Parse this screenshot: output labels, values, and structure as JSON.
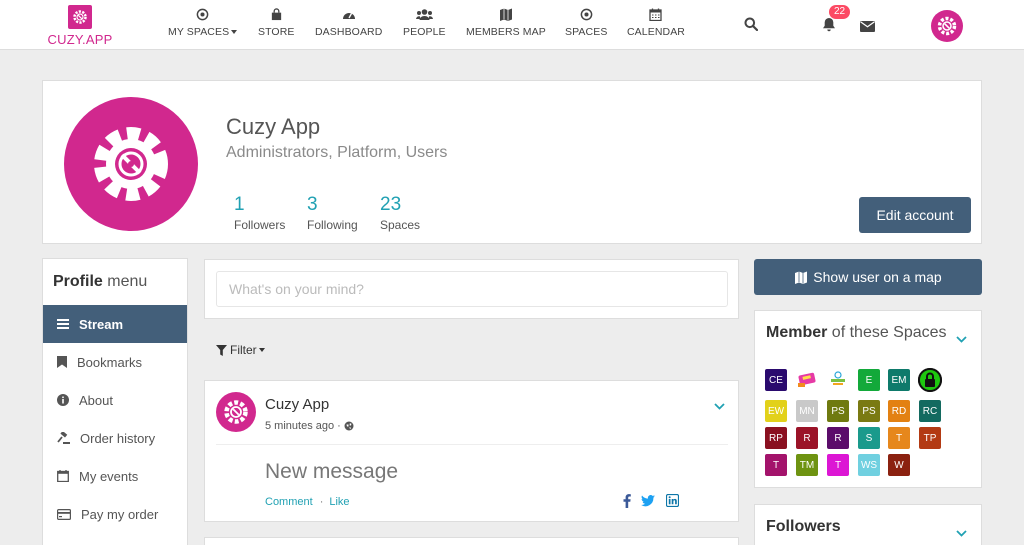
{
  "app": {
    "name": "CUZY.APP",
    "brand_color": "#d1288e",
    "accent_color": "#435f7a",
    "link_color": "#21a1b3"
  },
  "nav": {
    "items": [
      {
        "label": "MY SPACES",
        "icon": "dot-circle-icon"
      },
      {
        "label": "STORE",
        "icon": "shopping-bag-icon"
      },
      {
        "label": "DASHBOARD",
        "icon": "dashboard-gauge-icon"
      },
      {
        "label": "PEOPLE",
        "icon": "users-icon"
      },
      {
        "label": "MEMBERS MAP",
        "icon": "map-icon"
      },
      {
        "label": "SPACES",
        "icon": "dot-circle-icon"
      },
      {
        "label": "CALENDAR",
        "icon": "calendar-icon"
      }
    ],
    "notification_count": "22"
  },
  "profile": {
    "name": "Cuzy App",
    "groups": "Administrators, Platform, Users",
    "stats": [
      {
        "value": "1",
        "label": "Followers"
      },
      {
        "value": "3",
        "label": "Following"
      },
      {
        "value": "23",
        "label": "Spaces"
      }
    ],
    "edit_label": "Edit account"
  },
  "menu": {
    "title_bold": "Profile",
    "title_rest": " menu",
    "items": [
      {
        "label": "Stream",
        "icon": "bars-icon"
      },
      {
        "label": "Bookmarks",
        "icon": "bookmark-icon"
      },
      {
        "label": "About",
        "icon": "info-circle-icon"
      },
      {
        "label": "Order history",
        "icon": "gavel-icon"
      },
      {
        "label": "My events",
        "icon": "calendar-icon"
      },
      {
        "label": "Pay my order",
        "icon": "credit-card-icon"
      }
    ]
  },
  "stream": {
    "placeholder": "What's on your mind?",
    "filter_label": "Filter",
    "entry": {
      "author": "Cuzy App",
      "time": "5 minutes ago",
      "message": "New message",
      "comment_label": "Comment",
      "like_label": "Like"
    }
  },
  "sidebar": {
    "map_label": "Show user on a map",
    "spaces_title_bold": "Member",
    "spaces_title_rest": " of these Spaces",
    "spaces": [
      {
        "label": "CE",
        "color": "#2a0a6e"
      },
      {
        "label": "",
        "color": "#ffffff"
      },
      {
        "label": "",
        "color": "#ffffff"
      },
      {
        "label": "E",
        "color": "#13a93a"
      },
      {
        "label": "EM",
        "color": "#0e7a6b"
      },
      {
        "label": "",
        "color": "#111111"
      },
      {
        "label": "EW",
        "color": "#e2d11a"
      },
      {
        "label": "MN",
        "color": "#c9c9c9"
      },
      {
        "label": "PS",
        "color": "#6f7a10"
      },
      {
        "label": "PS",
        "color": "#7a7a12"
      },
      {
        "label": "RD",
        "color": "#e38112"
      },
      {
        "label": "RC",
        "color": "#136a60"
      },
      {
        "label": "RP",
        "color": "#8a1020"
      },
      {
        "label": "R",
        "color": "#9b1328"
      },
      {
        "label": "R",
        "color": "#5b0c6a"
      },
      {
        "label": "S",
        "color": "#1a9a8c"
      },
      {
        "label": "T",
        "color": "#e6871c"
      },
      {
        "label": "TP",
        "color": "#b33a13"
      },
      {
        "label": "T",
        "color": "#a3136b"
      },
      {
        "label": "TM",
        "color": "#6e9311"
      },
      {
        "label": "T",
        "color": "#dc16d4"
      },
      {
        "label": "WS",
        "color": "#70d0e0"
      },
      {
        "label": "W",
        "color": "#8b2110"
      }
    ],
    "followers_title": "Followers"
  }
}
